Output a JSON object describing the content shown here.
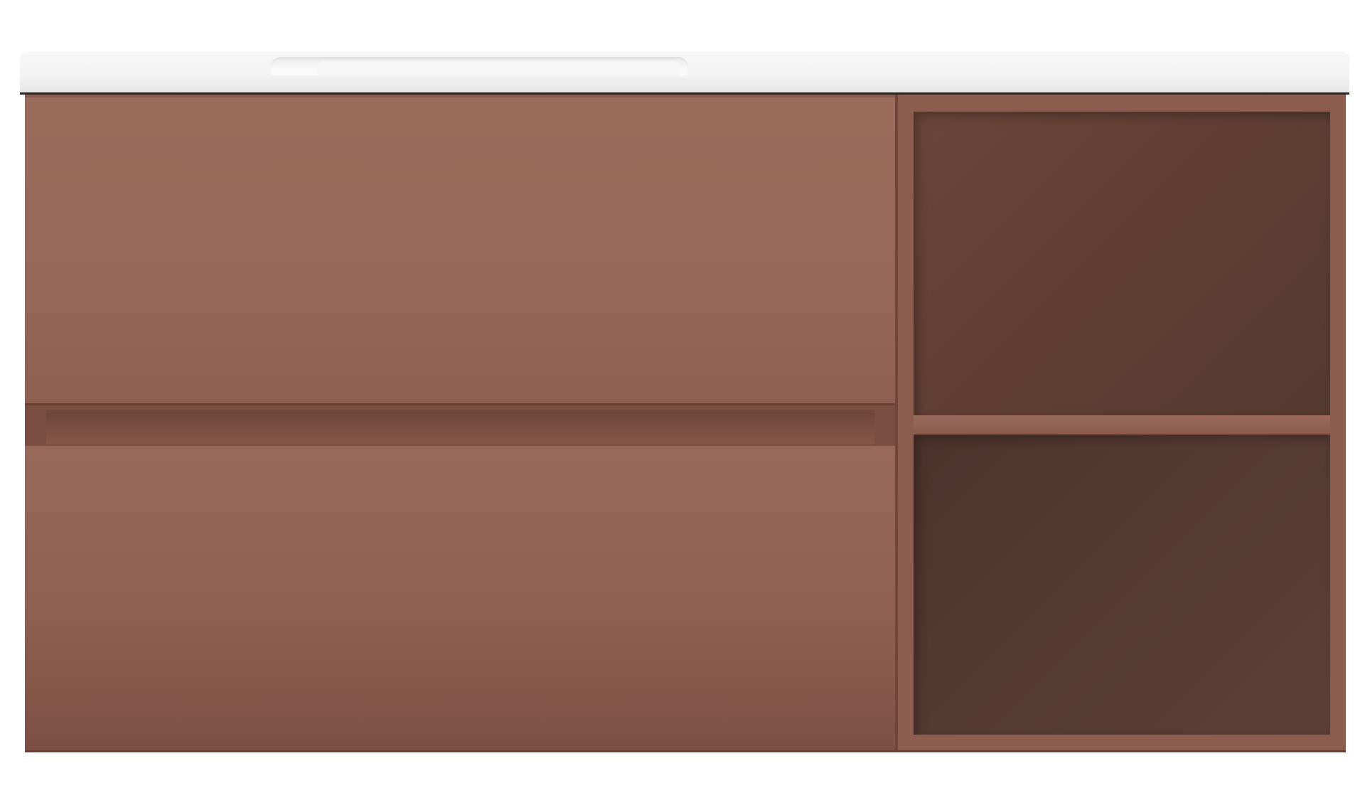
{
  "product": {
    "colors": {
      "countertop": "#f3f3f3",
      "cabinet": "#8a5a4c",
      "drawer_face": "#97685a",
      "shelf_interior": "#5e3e33"
    },
    "components": {
      "countertop": "integrated-basin-top",
      "drawers": 2,
      "open_shelves": 2
    }
  }
}
